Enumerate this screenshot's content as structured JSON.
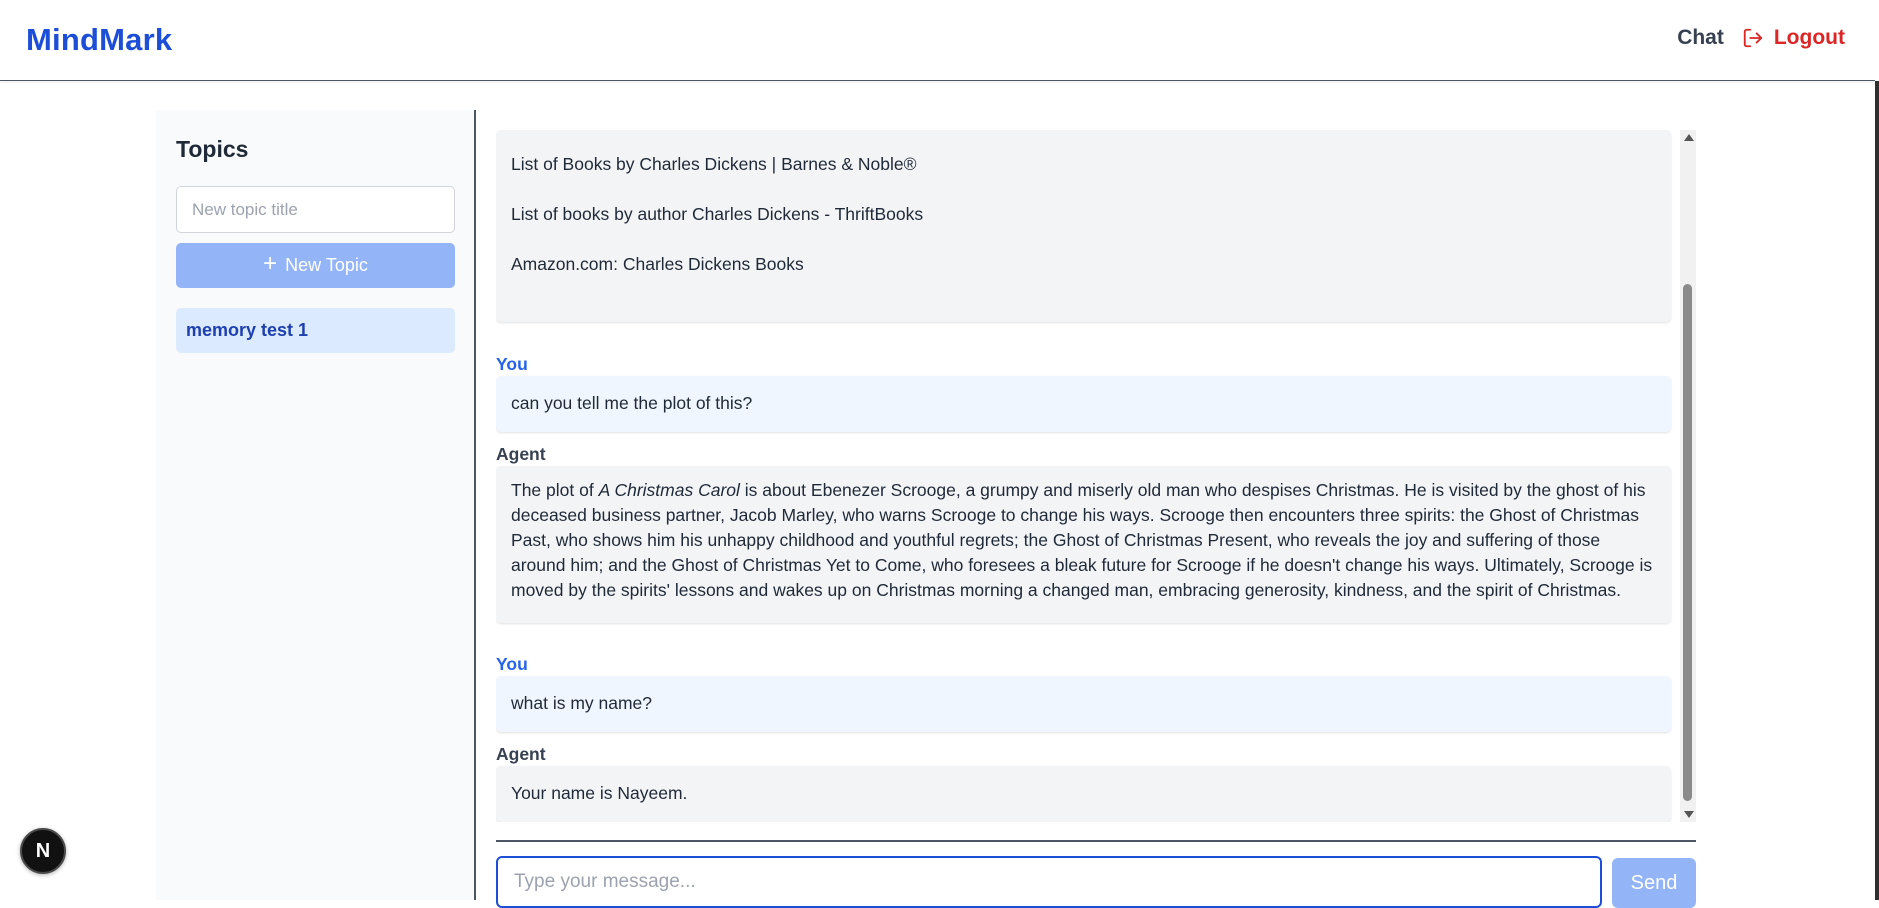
{
  "header": {
    "brand": "MindMark",
    "nav_chat": "Chat",
    "nav_logout": "Logout",
    "logout_icon": "logout-icon"
  },
  "sidebar": {
    "title": "Topics",
    "new_topic_placeholder": "New topic title",
    "new_topic_button": "New Topic",
    "topics": [
      {
        "label": "memory test 1",
        "active": true
      }
    ]
  },
  "chat": {
    "messages": [
      {
        "role": "Agent",
        "lines": [
          "List of Books by Charles Dickens | Barnes & Noble®",
          "List of books by author Charles Dickens - ThriftBooks",
          "Amazon.com: Charles Dickens Books"
        ]
      },
      {
        "role": "You",
        "text": "can you tell me the plot of this?"
      },
      {
        "role": "Agent",
        "text_pre": "The plot of ",
        "text_em": "A Christmas Carol",
        "text_post": " is about Ebenezer Scrooge, a grumpy and miserly old man who despises Christmas.  He is visited by the ghost of his deceased business partner, Jacob Marley, who warns Scrooge to change his ways. Scrooge then encounters three spirits: the Ghost of Christmas Past, who shows him his unhappy childhood and youthful regrets; the Ghost of Christmas Present, who reveals the joy and suffering of those around him; and the Ghost of Christmas Yet to Come, who foresees a bleak future for Scrooge if he doesn't change his ways.  Ultimately, Scrooge is moved by the spirits' lessons and wakes up on Christmas morning a changed man, embracing generosity, kindness, and the spirit of Christmas."
      },
      {
        "role": "You",
        "text": "what is my name?"
      },
      {
        "role": "Agent",
        "text": "Your name is Nayeem."
      }
    ]
  },
  "composer": {
    "placeholder": "Type your message...",
    "send_label": "Send"
  },
  "badge": {
    "label": "N"
  },
  "colors": {
    "brand": "#1d4ed8",
    "logout": "#dc2626",
    "button_disabled": "#93b4f7",
    "user_bubble": "#eff6ff",
    "agent_bubble": "#f3f4f6",
    "active_topic": "#dbeafe"
  }
}
